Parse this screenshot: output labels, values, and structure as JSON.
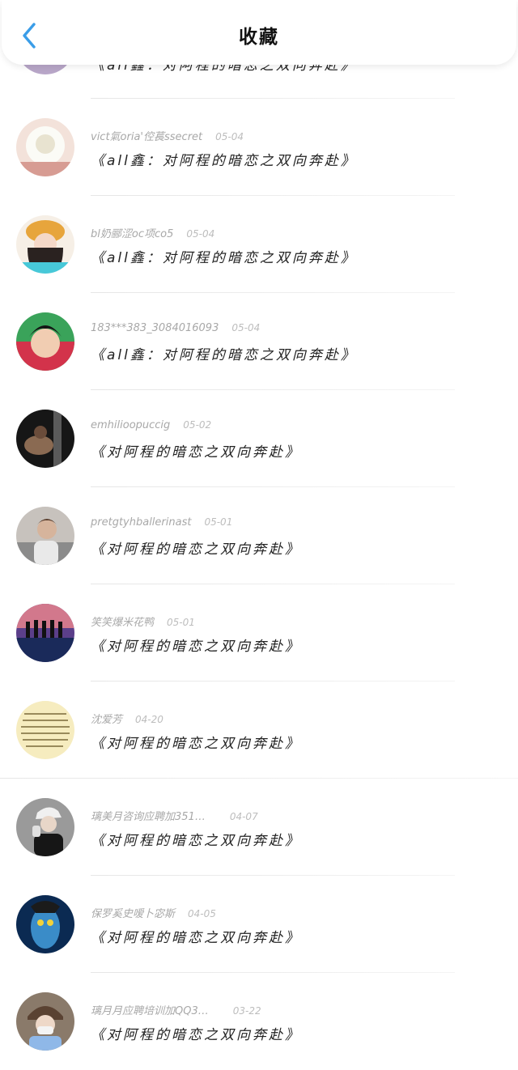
{
  "header": {
    "title": "收藏",
    "back_icon": "chevron-left-icon",
    "accent": "#3a9de8"
  },
  "top_partial_row": {
    "work": "《all鑫：对阿程的暗恋之双向奔赴》"
  },
  "items": [
    {
      "user": "vict氣oria'倥萇ssecret",
      "date": "05-04",
      "work": "《all鑫：对阿程的暗恋之双向奔赴》"
    },
    {
      "user": "bl奶郦涩oc项co5",
      "date": "05-04",
      "work": "《all鑫：对阿程的暗恋之双向奔赴》"
    },
    {
      "user": "183***383_3084016093",
      "date": "05-04",
      "work": "《all鑫：对阿程的暗恋之双向奔赴》"
    },
    {
      "user": "emhilioopuccig",
      "date": "05-02",
      "work": "《对阿程的暗恋之双向奔赴》"
    },
    {
      "user": "pretgtyhballerinast",
      "date": "05-01",
      "work": "《对阿程的暗恋之双向奔赴》"
    },
    {
      "user": "笑笑爆米花鸭",
      "date": "05-01",
      "work": "《对阿程的暗恋之双向奔赴》"
    },
    {
      "user": "沈爱芳",
      "date": "04-20",
      "work": "《对阿程的暗恋之双向奔赴》"
    },
    {
      "user": "璃美月咨询应聘加351…",
      "date": "04-07",
      "work": "《对阿程的暗恋之双向奔赴》"
    },
    {
      "user": "保罗奚史嗳卜宓斯",
      "date": "04-05",
      "work": "《对阿程的暗恋之双向奔赴》"
    },
    {
      "user": "璃月月应聘培训加QQ3…",
      "date": "03-22",
      "work": "《对阿程的暗恋之双向奔赴》"
    }
  ]
}
